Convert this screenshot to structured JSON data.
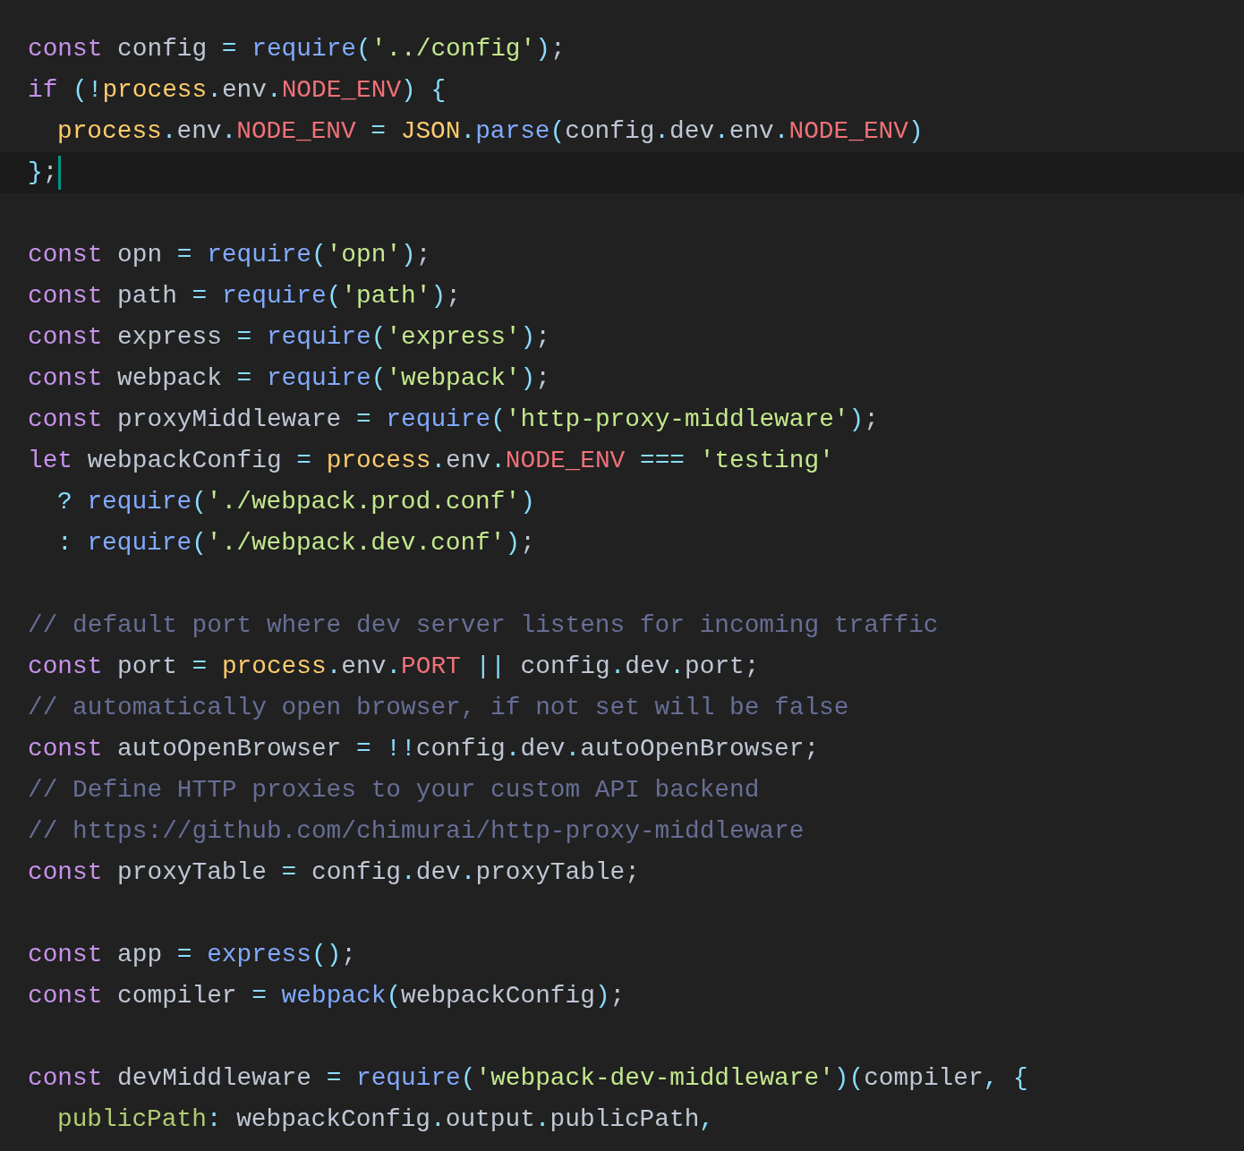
{
  "editor": {
    "lines": [
      {
        "kind": "code",
        "tokens": [
          {
            "kind": "keyword",
            "text": "const"
          },
          {
            "kind": "name",
            "text": " config "
          },
          {
            "kind": "operator",
            "text": "= "
          },
          {
            "kind": "function",
            "text": "require"
          },
          {
            "kind": "punctuation",
            "text": "("
          },
          {
            "kind": "string",
            "text": "'../config'"
          },
          {
            "kind": "punctuation",
            "text": ")"
          },
          {
            "kind": "name",
            "text": ";"
          }
        ]
      },
      {
        "kind": "code",
        "tokens": [
          {
            "kind": "keyword",
            "text": "if "
          },
          {
            "kind": "punctuation",
            "text": "(!"
          },
          {
            "kind": "global",
            "text": "process"
          },
          {
            "kind": "punctuation",
            "text": "."
          },
          {
            "kind": "name",
            "text": "env"
          },
          {
            "kind": "punctuation",
            "text": "."
          },
          {
            "kind": "property",
            "text": "NODE_ENV"
          },
          {
            "kind": "punctuation",
            "text": ") {"
          }
        ]
      },
      {
        "kind": "code",
        "indent": true,
        "tokens": [
          {
            "kind": "global",
            "text": "process"
          },
          {
            "kind": "punctuation",
            "text": "."
          },
          {
            "kind": "name",
            "text": "env"
          },
          {
            "kind": "punctuation",
            "text": "."
          },
          {
            "kind": "property",
            "text": "NODE_ENV "
          },
          {
            "kind": "operator",
            "text": "= "
          },
          {
            "kind": "global",
            "text": "JSON"
          },
          {
            "kind": "punctuation",
            "text": "."
          },
          {
            "kind": "function",
            "text": "parse"
          },
          {
            "kind": "punctuation",
            "text": "("
          },
          {
            "kind": "name",
            "text": "config"
          },
          {
            "kind": "punctuation",
            "text": "."
          },
          {
            "kind": "name",
            "text": "dev"
          },
          {
            "kind": "punctuation",
            "text": "."
          },
          {
            "kind": "name",
            "text": "env"
          },
          {
            "kind": "punctuation",
            "text": "."
          },
          {
            "kind": "property",
            "text": "NODE_ENV"
          },
          {
            "kind": "punctuation",
            "text": ")"
          }
        ]
      },
      {
        "kind": "code",
        "current": true,
        "tokens": [
          {
            "kind": "punctuation",
            "text": "}"
          },
          {
            "kind": "name",
            "text": ";"
          }
        ]
      },
      {
        "kind": "blank"
      },
      {
        "kind": "code",
        "tokens": [
          {
            "kind": "keyword",
            "text": "const"
          },
          {
            "kind": "name",
            "text": " opn "
          },
          {
            "kind": "operator",
            "text": "= "
          },
          {
            "kind": "function",
            "text": "require"
          },
          {
            "kind": "punctuation",
            "text": "("
          },
          {
            "kind": "string",
            "text": "'opn'"
          },
          {
            "kind": "punctuation",
            "text": ")"
          },
          {
            "kind": "name",
            "text": ";"
          }
        ]
      },
      {
        "kind": "code",
        "tokens": [
          {
            "kind": "keyword",
            "text": "const"
          },
          {
            "kind": "name",
            "text": " path "
          },
          {
            "kind": "operator",
            "text": "= "
          },
          {
            "kind": "function",
            "text": "require"
          },
          {
            "kind": "punctuation",
            "text": "("
          },
          {
            "kind": "string",
            "text": "'path'"
          },
          {
            "kind": "punctuation",
            "text": ")"
          },
          {
            "kind": "name",
            "text": ";"
          }
        ]
      },
      {
        "kind": "code",
        "tokens": [
          {
            "kind": "keyword",
            "text": "const"
          },
          {
            "kind": "name",
            "text": " express "
          },
          {
            "kind": "operator",
            "text": "= "
          },
          {
            "kind": "function",
            "text": "require"
          },
          {
            "kind": "punctuation",
            "text": "("
          },
          {
            "kind": "string",
            "text": "'express'"
          },
          {
            "kind": "punctuation",
            "text": ")"
          },
          {
            "kind": "name",
            "text": ";"
          }
        ]
      },
      {
        "kind": "code",
        "tokens": [
          {
            "kind": "keyword",
            "text": "const"
          },
          {
            "kind": "name",
            "text": " webpack "
          },
          {
            "kind": "operator",
            "text": "= "
          },
          {
            "kind": "function",
            "text": "require"
          },
          {
            "kind": "punctuation",
            "text": "("
          },
          {
            "kind": "string",
            "text": "'webpack'"
          },
          {
            "kind": "punctuation",
            "text": ")"
          },
          {
            "kind": "name",
            "text": ";"
          }
        ]
      },
      {
        "kind": "code",
        "tokens": [
          {
            "kind": "keyword",
            "text": "const"
          },
          {
            "kind": "name",
            "text": " proxyMiddleware "
          },
          {
            "kind": "operator",
            "text": "= "
          },
          {
            "kind": "function",
            "text": "require"
          },
          {
            "kind": "punctuation",
            "text": "("
          },
          {
            "kind": "string",
            "text": "'http-proxy-middleware'"
          },
          {
            "kind": "punctuation",
            "text": ")"
          },
          {
            "kind": "name",
            "text": ";"
          }
        ]
      },
      {
        "kind": "code",
        "tokens": [
          {
            "kind": "keyword",
            "text": "let"
          },
          {
            "kind": "name",
            "text": " webpackConfig "
          },
          {
            "kind": "operator",
            "text": "= "
          },
          {
            "kind": "global",
            "text": "process"
          },
          {
            "kind": "punctuation",
            "text": "."
          },
          {
            "kind": "name",
            "text": "env"
          },
          {
            "kind": "punctuation",
            "text": "."
          },
          {
            "kind": "property",
            "text": "NODE_ENV "
          },
          {
            "kind": "operator",
            "text": "=== "
          },
          {
            "kind": "string",
            "text": "'testing'"
          }
        ]
      },
      {
        "kind": "code",
        "indent": true,
        "tokens": [
          {
            "kind": "operator",
            "text": "? "
          },
          {
            "kind": "function",
            "text": "require"
          },
          {
            "kind": "punctuation",
            "text": "("
          },
          {
            "kind": "string",
            "text": "'./webpack.prod.conf'"
          },
          {
            "kind": "punctuation",
            "text": ")"
          }
        ]
      },
      {
        "kind": "code",
        "indent": true,
        "tokens": [
          {
            "kind": "operator",
            "text": ": "
          },
          {
            "kind": "function",
            "text": "require"
          },
          {
            "kind": "punctuation",
            "text": "("
          },
          {
            "kind": "string",
            "text": "'./webpack.dev.conf'"
          },
          {
            "kind": "punctuation",
            "text": ")"
          },
          {
            "kind": "name",
            "text": ";"
          }
        ]
      },
      {
        "kind": "blank"
      },
      {
        "kind": "comment",
        "text": "// default port where dev server listens for incoming traffic"
      },
      {
        "kind": "code",
        "tokens": [
          {
            "kind": "keyword",
            "text": "const"
          },
          {
            "kind": "name",
            "text": " port "
          },
          {
            "kind": "operator",
            "text": "= "
          },
          {
            "kind": "global",
            "text": "process"
          },
          {
            "kind": "punctuation",
            "text": "."
          },
          {
            "kind": "name",
            "text": "env"
          },
          {
            "kind": "punctuation",
            "text": "."
          },
          {
            "kind": "property",
            "text": "PORT "
          },
          {
            "kind": "operator",
            "text": "|| "
          },
          {
            "kind": "name",
            "text": "config"
          },
          {
            "kind": "punctuation",
            "text": "."
          },
          {
            "kind": "name",
            "text": "dev"
          },
          {
            "kind": "punctuation",
            "text": "."
          },
          {
            "kind": "name",
            "text": "port;"
          }
        ]
      },
      {
        "kind": "comment",
        "text": "// automatically open browser, if not set will be false"
      },
      {
        "kind": "code",
        "tokens": [
          {
            "kind": "keyword",
            "text": "const"
          },
          {
            "kind": "name",
            "text": " autoOpenBrowser "
          },
          {
            "kind": "operator",
            "text": "= !!"
          },
          {
            "kind": "name",
            "text": "config"
          },
          {
            "kind": "punctuation",
            "text": "."
          },
          {
            "kind": "name",
            "text": "dev"
          },
          {
            "kind": "punctuation",
            "text": "."
          },
          {
            "kind": "name",
            "text": "autoOpenBrowser;"
          }
        ]
      },
      {
        "kind": "comment",
        "text": "// Define HTTP proxies to your custom API backend"
      },
      {
        "kind": "comment",
        "text": "// https://github.com/chimurai/http-proxy-middleware"
      },
      {
        "kind": "code",
        "tokens": [
          {
            "kind": "keyword",
            "text": "const"
          },
          {
            "kind": "name",
            "text": " proxyTable "
          },
          {
            "kind": "operator",
            "text": "= "
          },
          {
            "kind": "name",
            "text": "config"
          },
          {
            "kind": "punctuation",
            "text": "."
          },
          {
            "kind": "name",
            "text": "dev"
          },
          {
            "kind": "punctuation",
            "text": "."
          },
          {
            "kind": "name",
            "text": "proxyTable;"
          }
        ]
      },
      {
        "kind": "blank"
      },
      {
        "kind": "code",
        "tokens": [
          {
            "kind": "keyword",
            "text": "const"
          },
          {
            "kind": "name",
            "text": " app "
          },
          {
            "kind": "operator",
            "text": "= "
          },
          {
            "kind": "function",
            "text": "express"
          },
          {
            "kind": "punctuation",
            "text": "()"
          },
          {
            "kind": "name",
            "text": ";"
          }
        ]
      },
      {
        "kind": "code",
        "tokens": [
          {
            "kind": "keyword",
            "text": "const"
          },
          {
            "kind": "name",
            "text": " compiler "
          },
          {
            "kind": "operator",
            "text": "= "
          },
          {
            "kind": "function",
            "text": "webpack"
          },
          {
            "kind": "punctuation",
            "text": "("
          },
          {
            "kind": "name",
            "text": "webpackConfig"
          },
          {
            "kind": "punctuation",
            "text": ")"
          },
          {
            "kind": "name",
            "text": ";"
          }
        ]
      },
      {
        "kind": "blank"
      },
      {
        "kind": "code",
        "tokens": [
          {
            "kind": "keyword",
            "text": "const"
          },
          {
            "kind": "name",
            "text": " devMiddleware "
          },
          {
            "kind": "operator",
            "text": "= "
          },
          {
            "kind": "function",
            "text": "require"
          },
          {
            "kind": "punctuation",
            "text": "("
          },
          {
            "kind": "string",
            "text": "'webpack-dev-middleware'"
          },
          {
            "kind": "punctuation",
            "text": ")("
          },
          {
            "kind": "name",
            "text": "compiler"
          },
          {
            "kind": "punctuation",
            "text": ", {"
          }
        ]
      },
      {
        "kind": "code",
        "indent": true,
        "tokens": [
          {
            "kind": "key",
            "text": "publicPath"
          },
          {
            "kind": "punctuation",
            "text": ": "
          },
          {
            "kind": "name",
            "text": "webpackConfig"
          },
          {
            "kind": "punctuation",
            "text": "."
          },
          {
            "kind": "name",
            "text": "output"
          },
          {
            "kind": "punctuation",
            "text": "."
          },
          {
            "kind": "name",
            "text": "publicPath"
          },
          {
            "kind": "punctuation",
            "text": ","
          }
        ]
      }
    ]
  }
}
